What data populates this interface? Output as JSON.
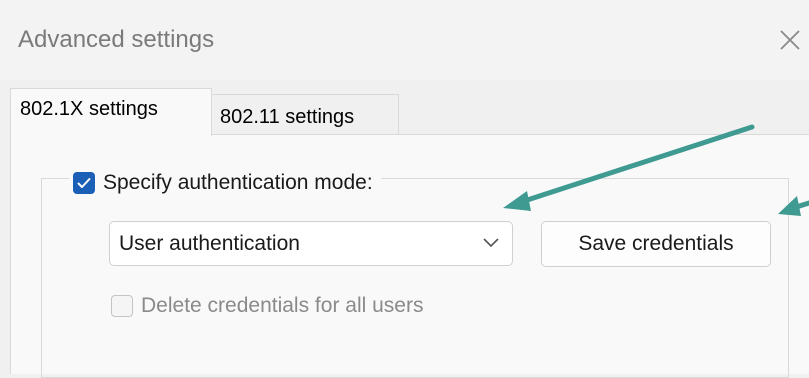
{
  "window": {
    "title": "Advanced settings"
  },
  "tabs": [
    {
      "label": "802.1X settings",
      "active": true
    },
    {
      "label": "802.11 settings",
      "active": false
    }
  ],
  "auth": {
    "specify_label": "Specify authentication mode:",
    "specify_checked": true,
    "mode_value": "User authentication",
    "save_button_label": "Save credentials",
    "delete_label": "Delete credentials for all users",
    "delete_checked": false,
    "delete_enabled": false
  },
  "colors": {
    "accent": "#1b5fb6",
    "annotation_arrow": "#3f9a92"
  },
  "icons": {
    "close": "close-icon",
    "dropdown": "chevron-down-icon",
    "check": "checkmark-icon"
  }
}
